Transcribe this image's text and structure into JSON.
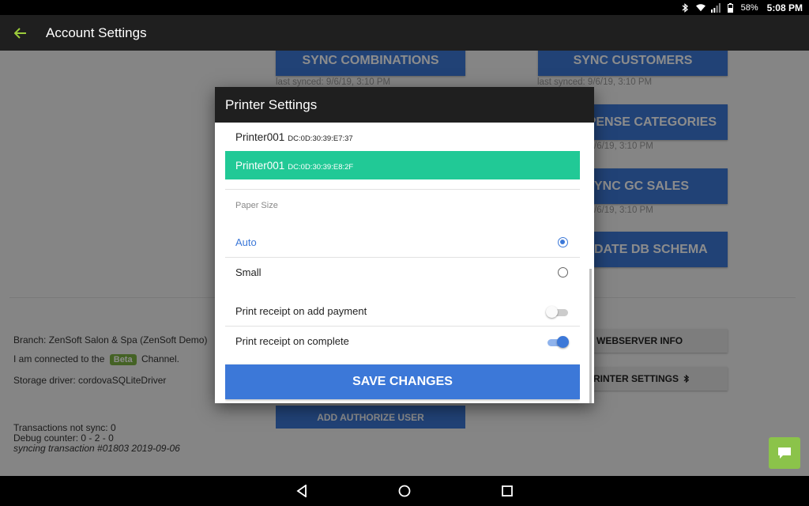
{
  "status_bar": {
    "battery_percent": "58%",
    "time": "5:08 PM",
    "icons": [
      "bluetooth-icon",
      "wifi-icon",
      "signal-icon",
      "battery-icon"
    ]
  },
  "app_bar": {
    "title": "Account Settings",
    "back_icon": "arrow-left-icon",
    "back_color": "#9ccc3b"
  },
  "background": {
    "sync_buttons": [
      {
        "label": "SYNC COMBINATIONS",
        "synced": "last synced: 9/6/19, 3:10 PM"
      },
      {
        "label": "SYNC CUSTOMERS",
        "synced": "last synced: 9/6/19, 3:10 PM"
      },
      {
        "label": "XPENSE CATEGORIES",
        "synced": "/6/19, 3:10 PM"
      },
      {
        "label": "YNC GC SALES",
        "synced": "/6/19, 3:10 PM"
      },
      {
        "label": "DATE DB SCHEMA"
      }
    ],
    "grey_buttons": {
      "webserver_info": "WEBSERVER INFO",
      "printer_settings": "RINTER SETTINGS"
    },
    "add_authorize_user": "ADD AUTHORIZE USER",
    "info": {
      "branch": "Branch: ZenSoft Salon & Spa (ZenSoft Demo)",
      "connected_prefix": "I am connected to the",
      "channel_badge": "Beta",
      "connected_suffix": "Channel.",
      "storage_driver": "Storage driver: cordovaSQLiteDriver",
      "transactions": "Transactions not sync: 0",
      "debug_counter": "Debug counter: 0 - 2 - 0",
      "syncing": "syncing transaction #01803 2019-09-06"
    },
    "chat_icon": "chat-bubble-icon"
  },
  "modal": {
    "title": "Printer Settings",
    "printers": [
      {
        "name": "Printer001",
        "mac": "DC:0D:30:39:E7:37",
        "selected": false
      },
      {
        "name": "Printer001",
        "mac": "DC:0D:30:39:E8:2F",
        "selected": true
      }
    ],
    "paper_size_label": "Paper Size",
    "paper_options": [
      {
        "label": "Auto",
        "checked": true
      },
      {
        "label": "Small",
        "checked": false
      }
    ],
    "toggles": [
      {
        "label": "Print receipt on add payment",
        "on": false
      },
      {
        "label": "Print receipt on complete",
        "on": true
      }
    ],
    "save_label": "SAVE CHANGES"
  },
  "colors": {
    "accent_blue": "#3c78d8",
    "selected_green": "#21c996",
    "beta_green": "#7cb342",
    "header_dark": "#1f1f1f"
  },
  "nav_bar": {
    "icons": [
      "back-triangle-icon",
      "home-circle-icon",
      "recents-square-icon"
    ]
  }
}
